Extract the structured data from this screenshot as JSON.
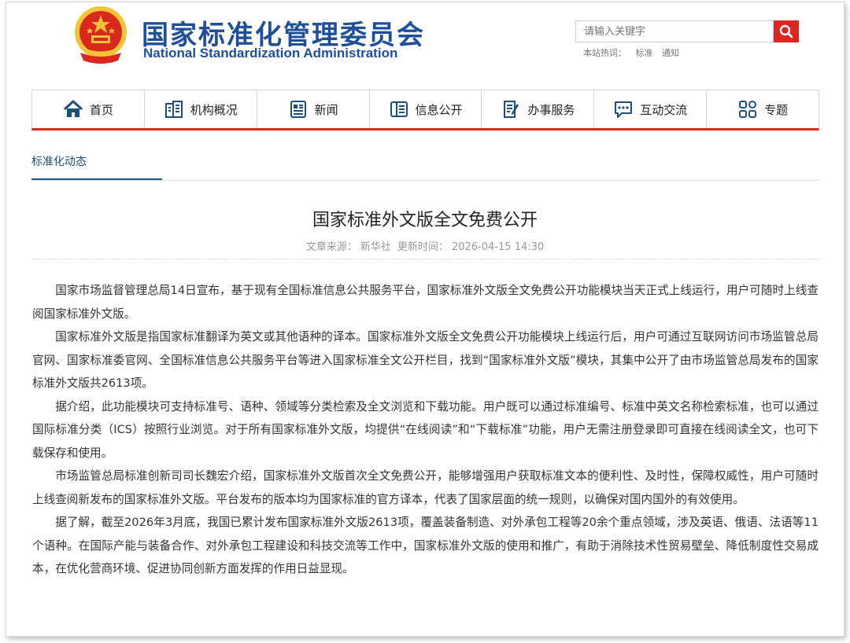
{
  "header": {
    "title_cn": "国家标准化管理委员会",
    "title_en": "National Standardization Administration",
    "search_placeholder": "请输入关键字",
    "hot_label": "本站热词：",
    "hot_words": [
      "标准",
      "通知"
    ]
  },
  "nav": [
    {
      "label": "首页",
      "icon": "home-icon"
    },
    {
      "label": "机构概况",
      "icon": "building-icon"
    },
    {
      "label": "新闻",
      "icon": "news-icon"
    },
    {
      "label": "信息公开",
      "icon": "info-icon"
    },
    {
      "label": "办事服务",
      "icon": "service-icon"
    },
    {
      "label": "互动交流",
      "icon": "chat-icon"
    },
    {
      "label": "专题",
      "icon": "grid-icon"
    }
  ],
  "breadcrumb": "标准化动态",
  "article": {
    "title": "国家标准外文版全文免费公开",
    "source_label": "文章来源：",
    "source": "新华社",
    "updated_label": "更新时间：",
    "updated": "2026-04-15 14:30",
    "paragraphs": [
      "国家市场监督管理总局14日宣布，基于现有全国标准信息公共服务平台，国家标准外文版全文免费公开功能模块当天正式上线运行，用户可随时上线查阅国家标准外文版。",
      "国家标准外文版是指国家标准翻译为英文或其他语种的译本。国家标准外文版全文免费公开功能模块上线运行后，用户可通过互联网访问市场监管总局官网、国家标准委官网、全国标准信息公共服务平台等进入国家标准全文公开栏目，找到“国家标准外文版”模块，其集中公开了由市场监管总局发布的国家标准外文版共2613项。",
      "据介绍，此功能模块可支持标准号、语种、领域等分类检索及全文浏览和下载功能。用户既可以通过标准编号、标准中英文名称检索标准，也可以通过国际标准分类（ICS）按照行业浏览。对于所有国家标准外文版，均提供“在线阅读”和“下载标准”功能，用户无需注册登录即可直接在线阅读全文，也可下载保存和使用。",
      "市场监管总局标准创新司司长魏宏介绍，国家标准外文版首次全文免费公开，能够增强用户获取标准文本的便利性、及时性，保障权威性，用户可随时上线查阅新发布的国家标准外文版。平台发布的版本均为国家标准的官方译本，代表了国家层面的统一规则，以确保对国内国外的有效使用。",
      "据了解，截至2026年3月底，我国已累计发布国家标准外文版2613项，覆盖装备制造、对外承包工程等20余个重点领域，涉及英语、俄语、法语等11个语种。在国际产能与装备合作、对外承包工程建设和科技交流等工作中，国家标准外文版的使用和推广，有助于消除技术性贸易壁垒、降低制度性交易成本，在优化营商环境、促进协同创新方面发挥的作用日益显现。"
    ]
  },
  "colors": {
    "brand_blue": "#1d4f9b",
    "accent_red": "#d9281e",
    "emblem_gold": "#f3c436"
  }
}
